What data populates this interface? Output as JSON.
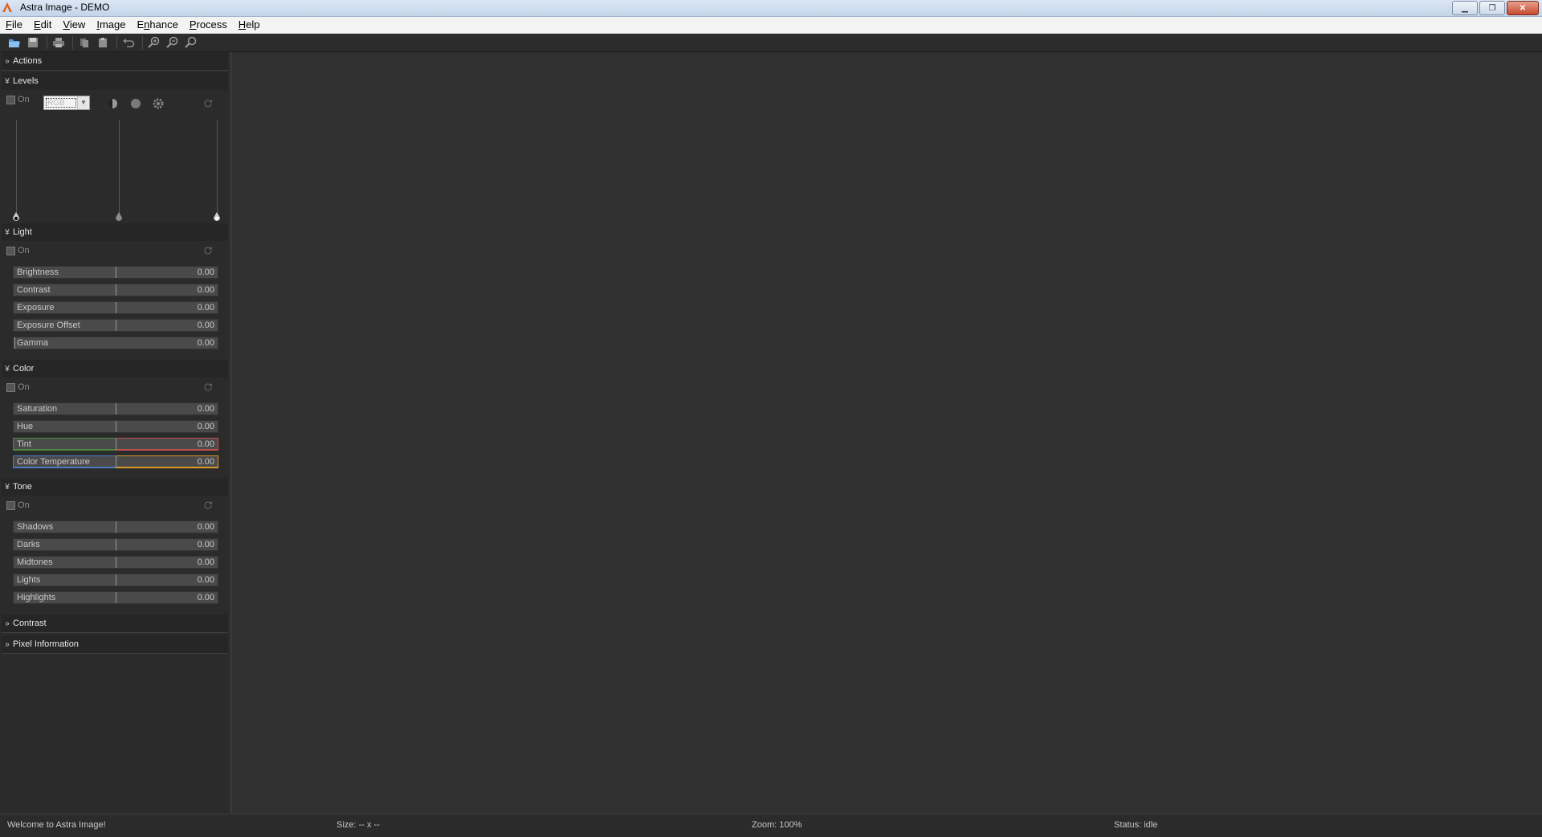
{
  "window": {
    "title": "Astra Image - DEMO",
    "buttons": [
      "minimize",
      "restore",
      "close"
    ]
  },
  "menu": [
    {
      "pre": "",
      "ul": "F",
      "post": "ile"
    },
    {
      "pre": "",
      "ul": "E",
      "post": "dit"
    },
    {
      "pre": "",
      "ul": "V",
      "post": "iew"
    },
    {
      "pre": "",
      "ul": "I",
      "post": "mage"
    },
    {
      "pre": "E",
      "ul": "n",
      "post": "hance"
    },
    {
      "pre": "",
      "ul": "P",
      "post": "rocess"
    },
    {
      "pre": "",
      "ul": "H",
      "post": "elp"
    }
  ],
  "toolbar": [
    "open-icon",
    "save-icon",
    "print-icon",
    "copy-icon",
    "paste-icon",
    "undo-icon",
    "zoom-in-icon",
    "zoom-out-icon",
    "zoom-fit-icon"
  ],
  "panel": {
    "actions": {
      "title": "Actions"
    },
    "levels": {
      "title": "Levels",
      "on_label": "On",
      "channel": "RGB"
    },
    "light": {
      "title": "Light",
      "on_label": "On",
      "sliders": [
        {
          "name": "Brightness",
          "value": "0.00"
        },
        {
          "name": "Contrast",
          "value": "0.00"
        },
        {
          "name": "Exposure",
          "value": "0.00"
        },
        {
          "name": "Exposure Offset",
          "value": "0.00"
        },
        {
          "name": "Gamma",
          "value": "0.00"
        }
      ]
    },
    "color": {
      "title": "Color",
      "on_label": "On",
      "sliders": [
        {
          "name": "Saturation",
          "value": "0.00"
        },
        {
          "name": "Hue",
          "value": "0.00"
        },
        {
          "name": "Tint",
          "value": "0.00"
        },
        {
          "name": "Color Temperature",
          "value": "0.00"
        }
      ]
    },
    "tone": {
      "title": "Tone",
      "on_label": "On",
      "sliders": [
        {
          "name": "Shadows",
          "value": "0.00"
        },
        {
          "name": "Darks",
          "value": "0.00"
        },
        {
          "name": "Midtones",
          "value": "0.00"
        },
        {
          "name": "Lights",
          "value": "0.00"
        },
        {
          "name": "Highlights",
          "value": "0.00"
        }
      ]
    },
    "contrast": {
      "title": "Contrast"
    },
    "pixel_info": {
      "title": "Pixel Information"
    }
  },
  "status": {
    "welcome": "Welcome to Astra Image!",
    "size": "Size: -- x --",
    "zoom": "Zoom: 100%",
    "state": "Status: idle"
  },
  "colors": {
    "background": "#303030",
    "panel": "#2b2b2b",
    "slider": "#4a4a4a",
    "tint_left": "#4a8a3a",
    "tint_right": "#c0504d",
    "temp_left": "#4a7ac0",
    "temp_right": "#d89a2a"
  }
}
